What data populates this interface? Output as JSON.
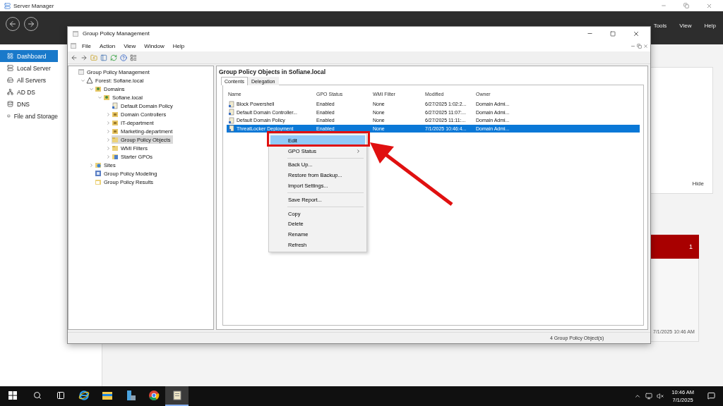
{
  "server_manager": {
    "title": "Server Manager",
    "menu": [
      "Tools",
      "View",
      "Help"
    ],
    "sidebar": [
      {
        "label": "Dashboard",
        "kind": "dashboard",
        "selected": true
      },
      {
        "label": "Local Server",
        "kind": "server",
        "selected": false
      },
      {
        "label": "All Servers",
        "kind": "servers",
        "selected": false
      },
      {
        "label": "AD DS",
        "kind": "adds",
        "selected": false
      },
      {
        "label": "DNS",
        "kind": "dns",
        "selected": false
      },
      {
        "label": "File and Storage",
        "kind": "storage",
        "selected": false
      }
    ],
    "hide_link": "Hide",
    "alert_count": "1",
    "timestamp": "7/1/2025 10:46 AM"
  },
  "gpmc": {
    "title": "Group Policy Management",
    "menu": [
      "File",
      "Action",
      "View",
      "Window",
      "Help"
    ],
    "tree": [
      {
        "label": "Group Policy Management",
        "kind": "console",
        "selected": false,
        "children": [
          {
            "label": "Forest: Sofiane.local",
            "kind": "forest",
            "expanded": true,
            "selected": false,
            "children": [
              {
                "label": "Domains",
                "kind": "domains",
                "expanded": true,
                "selected": false,
                "children": [
                  {
                    "label": "Sofiane.local",
                    "kind": "domain",
                    "expanded": true,
                    "selected": false,
                    "children": [
                      {
                        "label": "Default Domain Policy",
                        "kind": "gpo",
                        "selected": false
                      },
                      {
                        "label": "Domain Controllers",
                        "kind": "ou",
                        "expanded": false,
                        "selected": false
                      },
                      {
                        "label": "IT-department",
                        "kind": "ou",
                        "expanded": false,
                        "selected": false
                      },
                      {
                        "label": "Marketing-department",
                        "kind": "ou",
                        "expanded": false,
                        "selected": false
                      },
                      {
                        "label": "Group Policy Objects",
                        "kind": "folder",
                        "expanded": false,
                        "selected": true
                      },
                      {
                        "label": "WMI Filters",
                        "kind": "folder",
                        "expanded": false,
                        "selected": false
                      },
                      {
                        "label": "Starter GPOs",
                        "kind": "starter",
                        "expanded": false,
                        "selected": false
                      }
                    ]
                  }
                ]
              },
              {
                "label": "Sites",
                "kind": "sites",
                "expanded": false,
                "selected": false
              },
              {
                "label": "Group Policy Modeling",
                "kind": "modeling",
                "selected": false
              },
              {
                "label": "Group Policy Results",
                "kind": "results",
                "selected": false
              }
            ]
          }
        ]
      }
    ],
    "heading": "Group Policy Objects in Sofiane.local",
    "tabs": [
      {
        "label": "Contents",
        "selected": true
      },
      {
        "label": "Delegation",
        "selected": false
      }
    ],
    "columns": [
      "Name",
      "GPO Status",
      "WMI Filter",
      "Modified",
      "Owner"
    ],
    "rows": [
      {
        "cells": [
          "Block Powershell",
          "Enabled",
          "None",
          "6/27/2025 1:02:2...",
          "Domain Admi..."
        ],
        "selected": false
      },
      {
        "cells": [
          "Default Domain Controller...",
          "Enabled",
          "None",
          "6/27/2025 11:07:...",
          "Domain Admi..."
        ],
        "selected": false
      },
      {
        "cells": [
          "Default Domain Policy",
          "Enabled",
          "None",
          "6/27/2025 11:11:...",
          "Domain Admi..."
        ],
        "selected": false
      },
      {
        "cells": [
          "ThreatLocker Deployment",
          "Enabled",
          "None",
          "7/1/2025 10:46:4...",
          "Domain Admi..."
        ],
        "selected": true
      }
    ],
    "context_menu": [
      {
        "kind": "item",
        "label": "Edit",
        "selected": true
      },
      {
        "kind": "submenu",
        "label": "GPO Status",
        "selected": false
      },
      {
        "kind": "separator"
      },
      {
        "kind": "item",
        "label": "Back Up...",
        "selected": false
      },
      {
        "kind": "item",
        "label": "Restore from Backup...",
        "selected": false
      },
      {
        "kind": "item",
        "label": "Import Settings...",
        "selected": false
      },
      {
        "kind": "separator"
      },
      {
        "kind": "item",
        "label": "Save Report...",
        "selected": false
      },
      {
        "kind": "separator"
      },
      {
        "kind": "item",
        "label": "Copy",
        "selected": false
      },
      {
        "kind": "item",
        "label": "Delete",
        "selected": false
      },
      {
        "kind": "item",
        "label": "Rename",
        "selected": false
      },
      {
        "kind": "item",
        "label": "Refresh",
        "selected": false
      }
    ],
    "status": "4 Group Policy Object(s)"
  },
  "taskbar": {
    "apps": [
      {
        "kind": "ie",
        "active": false
      },
      {
        "kind": "explorer",
        "active": false
      },
      {
        "kind": "server-manager",
        "active": false
      },
      {
        "kind": "chrome",
        "active": false
      },
      {
        "kind": "gpmc",
        "active": true
      }
    ],
    "time": "10:46 AM",
    "date": "7/1/2025"
  }
}
